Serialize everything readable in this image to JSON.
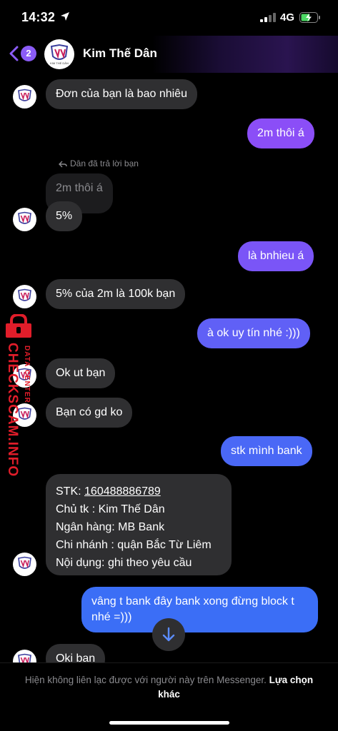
{
  "status_bar": {
    "time": "14:32",
    "network": "4G"
  },
  "header": {
    "unread_count": "2",
    "contact_name": "Kim Thế Dân",
    "avatar_caption": "KIM THẾ DÂN"
  },
  "messages": [
    {
      "side": "in",
      "text": "Đơn của bạn là bao nhiêu"
    },
    {
      "side": "out",
      "text": "2m thôi á"
    },
    {
      "side": "reply-note",
      "text": "Dân đã trả lời bạn"
    },
    {
      "side": "quote",
      "text": "2m thôi á"
    },
    {
      "side": "in",
      "text": "5%"
    },
    {
      "side": "out",
      "text": "là bnhieu á"
    },
    {
      "side": "in",
      "text": "5% của 2m là 100k bạn"
    },
    {
      "side": "out",
      "text": "à ok uy tín nhé :)))"
    },
    {
      "side": "in",
      "text": "Ok ut bạn"
    },
    {
      "side": "in",
      "text": "Bạn có gd ko"
    },
    {
      "side": "out",
      "text": "stk mình bank"
    },
    {
      "side": "out",
      "text": "vâng t bank đây bank xong đừng block t nhé =)))"
    },
    {
      "side": "in",
      "text": "Oki bạn"
    }
  ],
  "bank_card": {
    "account_label": "STK: ",
    "account_number": "160488886789",
    "holder": "Chủ tk : Kim Thế Dân",
    "bank": "Ngân hàng: MB Bank",
    "branch": "Chi nhánh : quận Bắc Từ Liêm",
    "content": "Nội dụng: ghi theo yêu cầu"
  },
  "watermark": {
    "brand": "CHECKSCAM.INFO",
    "sub": "DATA CENTER"
  },
  "footer": {
    "notice": "Hiện không liên lạc được với người này trên Messenger. ",
    "link": "Lựa chọn khác"
  },
  "colors": {
    "outgoing_top": "#8b4ef7",
    "outgoing_bottom": "#3b6ef6",
    "incoming": "#2f2f31",
    "accent": "#8b5cf6",
    "watermark": "#e11d2a"
  },
  "icons": [
    "location-arrow-icon",
    "signal-icon",
    "battery-charging-icon",
    "back-chevron-icon",
    "reply-icon",
    "arrow-down-icon",
    "lock-icon"
  ]
}
